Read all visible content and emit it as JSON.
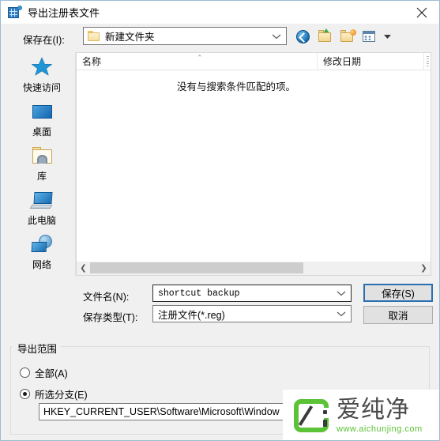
{
  "window": {
    "title": "导出注册表文件",
    "icon": "registry-export-icon",
    "close_label": "✕"
  },
  "lookin": {
    "label": "保存在(I):",
    "value": "新建文件夹",
    "folder_icon": "folder-icon",
    "dropdown_icon": "chevron-down-icon"
  },
  "toolbar": {
    "buttons": [
      {
        "name": "back-button",
        "icon": "back-arrow-icon"
      },
      {
        "name": "up-one-level-button",
        "icon": "folder-up-icon"
      },
      {
        "name": "new-folder-button",
        "icon": "new-folder-icon"
      },
      {
        "name": "views-button",
        "icon": "views-grid-icon"
      }
    ],
    "views_caret": "▾"
  },
  "places": {
    "items": [
      {
        "label": "快速访问",
        "icon": "star-icon"
      },
      {
        "label": "桌面",
        "icon": "desktop-icon"
      },
      {
        "label": "库",
        "icon": "library-icon"
      },
      {
        "label": "此电脑",
        "icon": "this-pc-icon"
      },
      {
        "label": "网络",
        "icon": "network-icon"
      }
    ]
  },
  "filelist": {
    "columns": [
      {
        "label": "名称"
      },
      {
        "label": "修改日期"
      }
    ],
    "sort_caret": "⌃",
    "empty_message": "没有与搜索条件匹配的项。",
    "rows": [],
    "scroll_left_arrow": "❮",
    "scroll_right_arrow": "❯"
  },
  "form": {
    "filename_label": "文件名(N):",
    "filename_value": "shortcut backup",
    "filetype_label": "保存类型(T):",
    "filetype_value": "注册文件(*.reg)",
    "save_button": "保存(S)",
    "cancel_button": "取消",
    "dropdown_icon": "chevron-down-icon"
  },
  "export_range": {
    "title": "导出范围",
    "options": [
      {
        "label": "全部(A)",
        "selected": false
      },
      {
        "label": "所选分支(E)",
        "selected": true
      }
    ],
    "branch_path": "HKEY_CURRENT_USER\\Software\\Microsoft\\Window"
  },
  "watermark": {
    "brand": "爱纯净",
    "url": "www.aichunjing.com",
    "accent_color": "#5cc236"
  },
  "colors": {
    "dialog_bg": "#f0f0f0",
    "dialog_border": "#9bbcd4",
    "focus_blue": "#2c6fb0",
    "list_bg": "#ffffff"
  }
}
